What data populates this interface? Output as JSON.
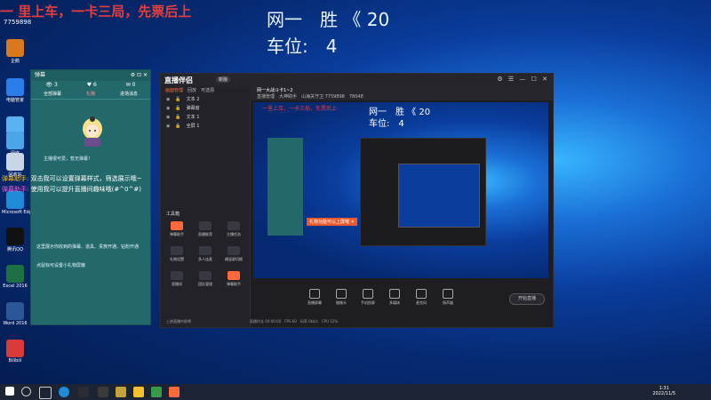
{
  "overlay": {
    "red_text": "一 里上车，一卡三局，先票后上",
    "id_text": "7759898",
    "win_text": "网一　胜 《 20",
    "seat_text": "车位:　4"
  },
  "desktop_icons": [
    {
      "label": "企鹅",
      "icon": "app-icon",
      "color": "#d9781c"
    },
    {
      "label": "电脑管家",
      "icon": "shield-icon",
      "color": "#2b7de9"
    },
    {
      "label": "此电脑",
      "icon": "computer-icon",
      "color": "#5bb2f0"
    },
    {
      "label": "网络",
      "icon": "network-icon",
      "color": "#4ba6e8"
    },
    {
      "label": "回收站",
      "icon": "recycle-bin-icon",
      "color": "#c9d6e6"
    },
    {
      "label": "Microsoft Edge",
      "icon": "edge-icon",
      "color": "#1e8ad8"
    },
    {
      "label": "腾讯QQ",
      "icon": "qq-icon",
      "color": "#111111"
    },
    {
      "label": "Excel 2016",
      "icon": "excel-icon",
      "color": "#1d7044"
    },
    {
      "label": "Word 2016",
      "icon": "word-icon",
      "color": "#2b5797"
    },
    {
      "label": "Bilibili",
      "icon": "app-icon",
      "color": "#d93b3b"
    }
  ],
  "chat_window": {
    "title": "弹幕",
    "controls": "⚙ ⊡ ✕",
    "stats": [
      "👁 3",
      "♥ 6",
      "✉ 0"
    ],
    "tabs": [
      "全部弹幕",
      "礼物",
      "进场消息"
    ],
    "mascot_text": "主播很可爱，暂无弹幕！",
    "tip1": "这里展示你收到的弹幕、道具、贵族开通、钻粉开通",
    "tip2": "点鼠标可设置小礼物屏蔽"
  },
  "danmaku": [
    {
      "name": "弹幕助手:",
      "text": " 双击我可以设置弹幕样式，筛选展示哦~"
    },
    {
      "name": "弹幕助手:",
      "text": " 使用我可以提升直播间趣味哦(#^0^#)"
    }
  ],
  "app": {
    "logo": "直播伴侣",
    "version": "新版",
    "window_controls": "⚙ ☰ — ☐ ✕",
    "left_tabs": [
      "画面管理",
      "回放",
      "可选源"
    ],
    "layers": [
      "文本 2",
      "弹幕窗",
      "文本 1",
      "全屏 1"
    ],
    "toolbox_title": "工具箱",
    "tools": [
      {
        "label": "弹幕助手",
        "hot": true
      },
      {
        "label": "直播推荐",
        "hot": false
      },
      {
        "label": "主播任务",
        "hot": false
      },
      {
        "label": "礼物设置",
        "hot": false
      },
      {
        "label": "多人连麦",
        "hot": false
      },
      {
        "label": "横竖屏切换",
        "hot": false
      },
      {
        "label": "直播间",
        "hot": false
      },
      {
        "label": "团队管理",
        "hot": false
      },
      {
        "label": "弹幕助手",
        "hot": true
      }
    ],
    "sub_title": "网一大战斗卡1~2",
    "sub_info": "直播管理　大神助手　山海关守卫 7759898　78048",
    "preview": {
      "red": "一里上车，一卡三局，先票后上",
      "win": "网一　胜 《 20",
      "seat": "车位:　4",
      "banner": "礼物功能可以上屏哦 ✕"
    },
    "bottom_tools": [
      "直播屏幕",
      "摄像头",
      "手机投屏",
      "多媒体",
      "麦克风",
      "扬声器"
    ],
    "go_live": "开始直播",
    "status_left": "上热直播中即将",
    "status_bottom": "直播时长 00:00:00　FPS 60　码率 0kb/s　CPU 12%"
  },
  "taskbar": {
    "time": "1:31",
    "date": "2022/11/5"
  }
}
